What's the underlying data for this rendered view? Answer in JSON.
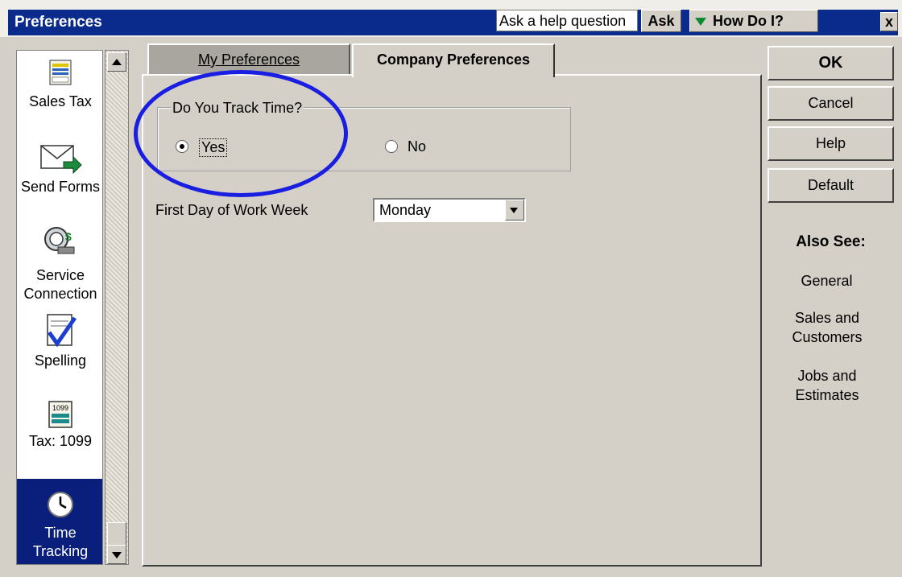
{
  "window": {
    "title": "Preferences",
    "help_placeholder": "Ask a help question",
    "ask_label": "Ask",
    "howdoi_label": "How Do I?",
    "close_label": "x"
  },
  "sidebar": {
    "items": [
      {
        "label": "Sales Tax",
        "icon": "sales-tax-icon"
      },
      {
        "label": "Send Forms",
        "icon": "envelope-icon"
      },
      {
        "label": "Service Connection",
        "icon": "service-connection-icon"
      },
      {
        "label": "Spelling",
        "icon": "spelling-check-icon"
      },
      {
        "label": "Tax: 1099",
        "icon": "tax-1099-icon"
      },
      {
        "label": "Time Tracking",
        "icon": "clock-icon",
        "active": true
      }
    ]
  },
  "tabs": [
    {
      "label": "My Preferences"
    },
    {
      "label": "Company Preferences",
      "active": true
    }
  ],
  "content": {
    "group_label": "Do You Track Time?",
    "option_yes": "Yes",
    "option_no": "No",
    "selected": "Yes",
    "work_week_label": "First Day of Work Week",
    "work_week_value": "Monday"
  },
  "buttons": {
    "ok": "OK",
    "cancel": "Cancel",
    "help": "Help",
    "default": "Default"
  },
  "also_see": {
    "title": "Also See:",
    "links": [
      "General",
      "Sales and Customers",
      "Jobs and Estimates"
    ]
  },
  "colors": {
    "title_bar": "#0a2a8c",
    "active_item": "#0a1f7c",
    "highlight_ellipse": "#1a1ee0"
  }
}
